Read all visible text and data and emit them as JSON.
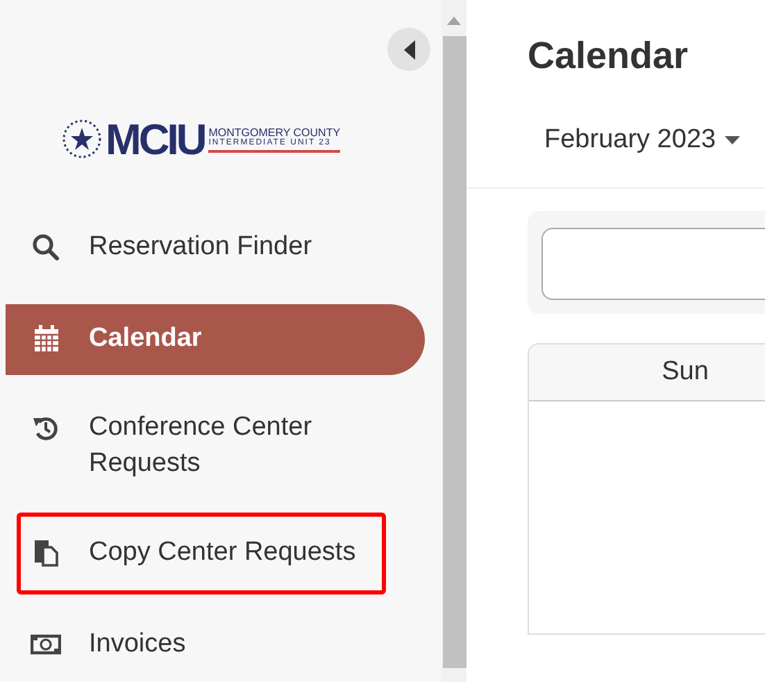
{
  "sidebar": {
    "logo": {
      "mark": "MCIU",
      "line_1": "MONTGOMERY COUNTY",
      "line_2": "INTERMEDIATE UNIT 23"
    },
    "items": [
      {
        "label": "Reservation Finder",
        "kind": "search",
        "selected": false,
        "highlighted": false
      },
      {
        "label": "Calendar",
        "kind": "calendar",
        "selected": true,
        "highlighted": false
      },
      {
        "label": "Conference Center Requests",
        "kind": "history",
        "selected": false,
        "highlighted": false
      },
      {
        "label": "Copy Center Requests",
        "kind": "copy",
        "selected": false,
        "highlighted": true
      },
      {
        "label": "Invoices",
        "kind": "money",
        "selected": false,
        "highlighted": false
      }
    ]
  },
  "main": {
    "title": "Calendar",
    "month": "February 2023",
    "table": {
      "columns": [
        "Sun"
      ]
    }
  }
}
